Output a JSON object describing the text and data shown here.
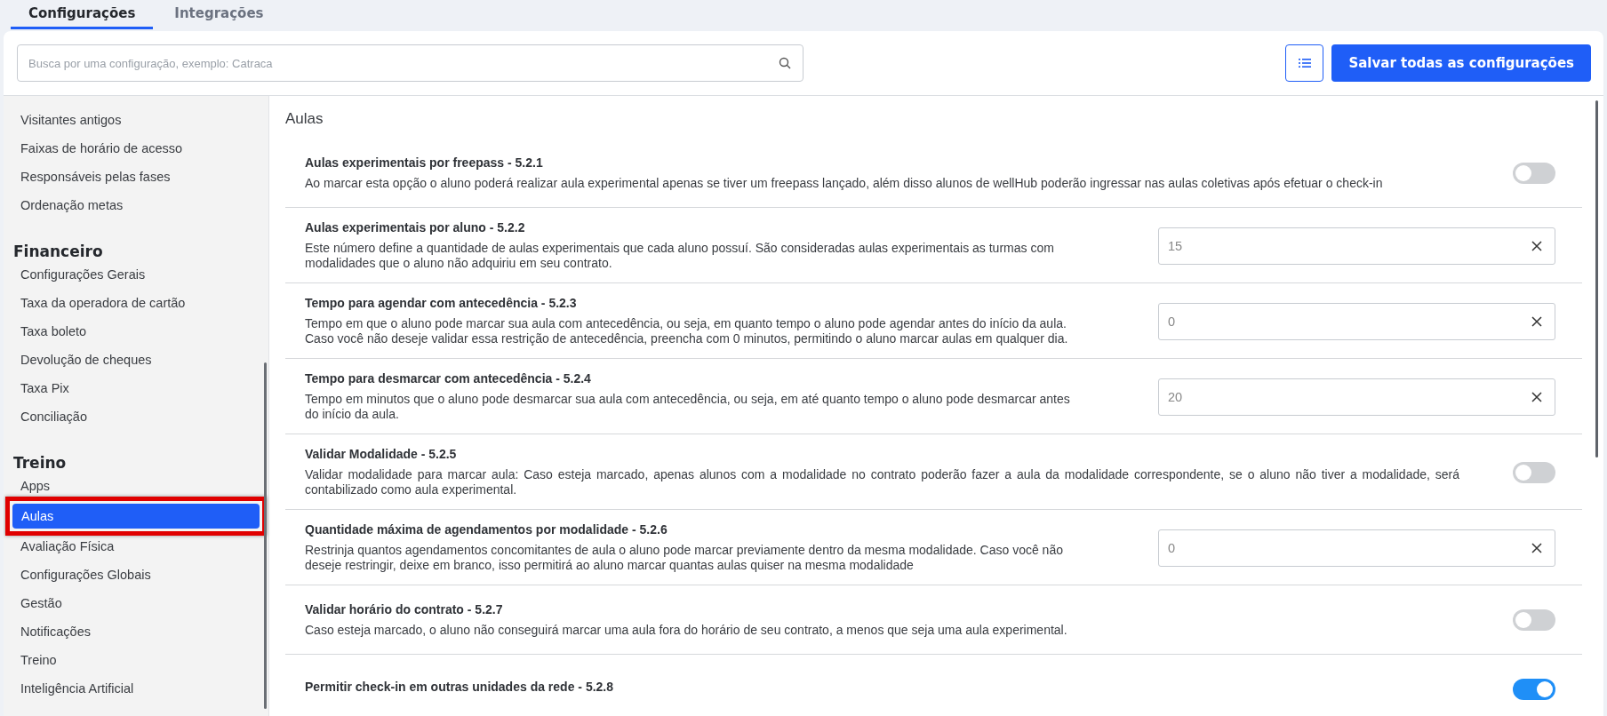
{
  "tabs": [
    {
      "label": "Configurações",
      "selected": true
    },
    {
      "label": "Integrações",
      "selected": false
    }
  ],
  "search": {
    "placeholder": "Busca por uma configuração, exemplo: Catraca"
  },
  "save_button": "Salvar todas as configurações",
  "sidebar": {
    "groups": [
      {
        "items": [
          {
            "label": "Visitantes antigos",
            "selected": false,
            "highlighted": false
          },
          {
            "label": "Faixas de horário de acesso",
            "selected": false,
            "highlighted": false
          },
          {
            "label": "Responsáveis pelas fases",
            "selected": false,
            "highlighted": false
          },
          {
            "label": "Ordenação metas",
            "selected": false,
            "highlighted": false
          }
        ]
      },
      {
        "heading": "Financeiro",
        "items": [
          {
            "label": "Configurações Gerais",
            "selected": false,
            "highlighted": false
          },
          {
            "label": "Taxa da operadora de cartão",
            "selected": false,
            "highlighted": false
          },
          {
            "label": "Taxa boleto",
            "selected": false,
            "highlighted": false
          },
          {
            "label": "Devolução de cheques",
            "selected": false,
            "highlighted": false
          },
          {
            "label": "Taxa Pix",
            "selected": false,
            "highlighted": false
          },
          {
            "label": "Conciliação",
            "selected": false,
            "highlighted": false
          }
        ]
      },
      {
        "heading": "Treino",
        "items": [
          {
            "label": "Apps",
            "selected": false,
            "highlighted": false
          },
          {
            "label": "Aulas",
            "selected": true,
            "highlighted": true
          },
          {
            "label": "Avaliação Física",
            "selected": false,
            "highlighted": false
          },
          {
            "label": "Configurações Globais",
            "selected": false,
            "highlighted": false
          },
          {
            "label": "Gestão",
            "selected": false,
            "highlighted": false
          },
          {
            "label": "Notificações",
            "selected": false,
            "highlighted": false
          },
          {
            "label": "Treino",
            "selected": false,
            "highlighted": false
          },
          {
            "label": "Inteligência Artificial",
            "selected": false,
            "highlighted": false
          }
        ]
      }
    ]
  },
  "content": {
    "title": "Aulas",
    "settings": [
      {
        "kind": "toggle",
        "title": "Aulas experimentais por freepass - 5.2.1",
        "description": "Ao marcar esta opção o aluno poderá realizar aula experimental apenas se tiver um freepass lançado, além disso alunos de wellHub poderão ingressar nas aulas coletivas após efetuar o check-in",
        "on": false
      },
      {
        "kind": "input",
        "title": "Aulas experimentais por aluno - 5.2.2",
        "description": "Este número define a quantidade de aulas experimentais que cada aluno possuí. São consideradas aulas experimentais as turmas com modalidades que o aluno não adquiriu em seu contrato.",
        "value": "15"
      },
      {
        "kind": "input",
        "title": "Tempo para agendar com antecedência - 5.2.3",
        "description": "Tempo em que o aluno pode marcar sua aula com antecedência, ou seja, em quanto tempo o aluno pode agendar antes do início da aula. Caso você não deseje validar essa restrição de antecedência, preencha com 0 minutos, permitindo o aluno marcar aulas em qualquer dia.",
        "value": "0"
      },
      {
        "kind": "input",
        "title": "Tempo para desmarcar com antecedência - 5.2.4",
        "description": "Tempo em minutos que o aluno pode desmarcar sua aula com antecedência, ou seja, em até quanto tempo o aluno pode desmarcar antes do início da aula.",
        "value": "20"
      },
      {
        "kind": "toggle",
        "title": "Validar Modalidade - 5.2.5",
        "description": "Validar modalidade para marcar aula: Caso esteja marcado, apenas alunos com a modalidade no contrato poderão fazer a aula da modalidade correspondente, se o aluno não tiver a modalidade, será contabilizado como aula experimental.",
        "on": false
      },
      {
        "kind": "input",
        "title": "Quantidade máxima de agendamentos por modalidade - 5.2.6",
        "description": "Restrinja quantos agendamentos concomitantes de aula o aluno pode marcar previamente dentro da mesma modalidade. Caso você não deseje restringir, deixe em branco, isso permitirá ao aluno marcar quantas aulas quiser na mesma modalidade",
        "value": "0"
      },
      {
        "kind": "toggle",
        "title": "Validar horário do contrato - 5.2.7",
        "description": "Caso esteja marcado, o aluno não conseguirá marcar uma aula fora do horário de seu contrato, a menos que seja uma aula experimental.",
        "on": false
      },
      {
        "kind": "toggle",
        "title": "Permitir check-in em outras unidades da rede - 5.2.8",
        "on": true
      }
    ]
  }
}
